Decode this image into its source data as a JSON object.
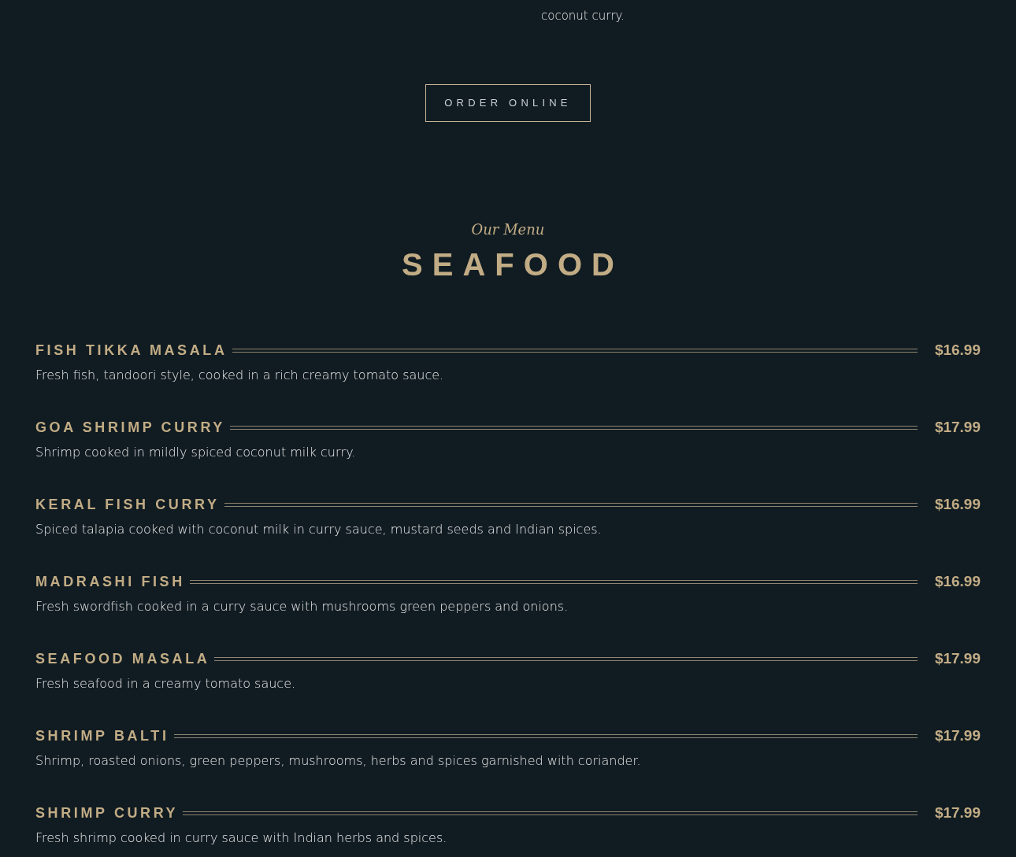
{
  "intro_tail": "coconut curry.",
  "order_button": "ORDER ONLINE",
  "section": {
    "eyebrow": "Our Menu",
    "title": "SEAFOOD"
  },
  "items": [
    {
      "name": "FISH TIKKA MASALA",
      "price": "$16.99",
      "description": "Fresh fish, tandoori style, cooked in a rich creamy tomato sauce."
    },
    {
      "name": "GOA SHRIMP CURRY",
      "price": "$17.99",
      "description": "Shrimp cooked in mildly spiced coconut milk curry."
    },
    {
      "name": "KERAL FISH CURRY",
      "price": "$16.99",
      "description": "Spiced talapia cooked with coconut milk in curry sauce, mustard seeds and Indian spices."
    },
    {
      "name": "MADRASHI FISH",
      "price": "$16.99",
      "description": "Fresh swordfish cooked in a curry sauce with mushrooms green peppers and onions."
    },
    {
      "name": "SEAFOOD MASALA",
      "price": "$17.99",
      "description": "Fresh seafood in a creamy tomato sauce."
    },
    {
      "name": "SHRIMP BALTI",
      "price": "$17.99",
      "description": "Shrimp, roasted onions, green peppers, mushrooms, herbs and spices garnished with coriander."
    },
    {
      "name": "SHRIMP CURRY",
      "price": "$17.99",
      "description": "Fresh shrimp cooked in curry sauce with Indian herbs and spices."
    }
  ]
}
